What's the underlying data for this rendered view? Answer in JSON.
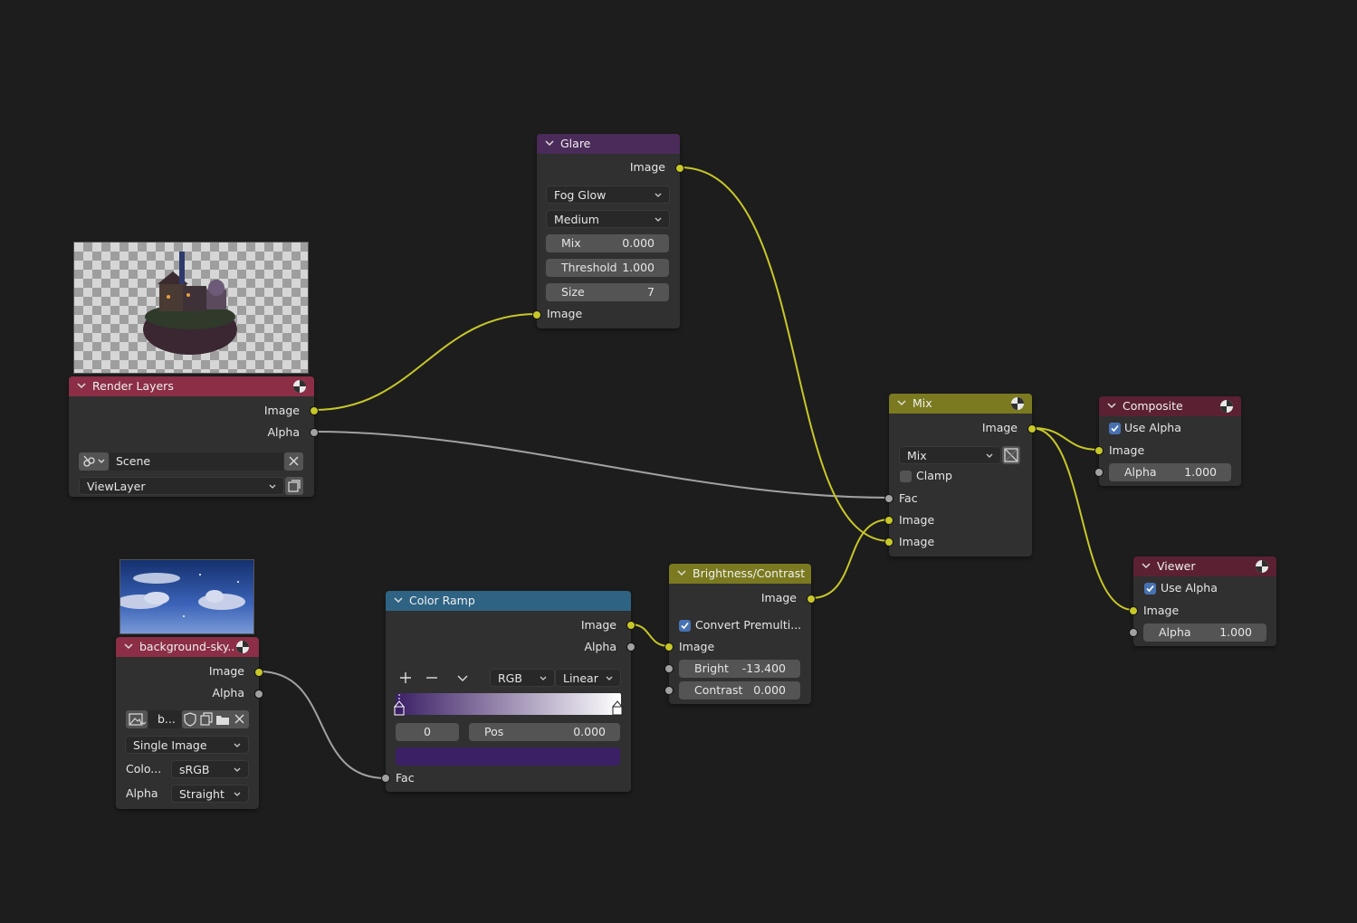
{
  "colors": {
    "render_header": "#8b2e46",
    "image_header": "#8b2e46",
    "output_header": "#5b2133",
    "glare_header": "#4a2b59",
    "mix_header": "#7b7a20",
    "brightness_header": "#7b7a20",
    "color_ramp_header": "#2e6384",
    "socket_yellow": "#c7c729",
    "socket_grey": "#a1a1a1",
    "ramp_stop_color": "#3c2066"
  },
  "glare": {
    "title": "Glare",
    "out_image": "Image",
    "type": "Fog Glow",
    "quality": "Medium",
    "mix_label": "Mix",
    "mix_value": "0.000",
    "threshold_label": "Threshold",
    "threshold_value": "1.000",
    "size_label": "Size",
    "size_value": "7",
    "in_image": "Image"
  },
  "render_layers": {
    "title": "Render Layers",
    "out_image": "Image",
    "out_alpha": "Alpha",
    "scene": "Scene",
    "view_layer": "ViewLayer"
  },
  "mix": {
    "title": "Mix",
    "out_image": "Image",
    "blend": "Mix",
    "clamp": "Clamp",
    "in_fac": "Fac",
    "in_image1": "Image",
    "in_image2": "Image"
  },
  "composite": {
    "title": "Composite",
    "use_alpha": "Use Alpha",
    "in_image": "Image",
    "alpha_label": "Alpha",
    "alpha_value": "1.000"
  },
  "viewer": {
    "title": "Viewer",
    "use_alpha": "Use Alpha",
    "in_image": "Image",
    "alpha_label": "Alpha",
    "alpha_value": "1.000"
  },
  "image_node": {
    "title": "background-sky...",
    "out_image": "Image",
    "out_alpha": "Alpha",
    "image_name": "b...",
    "source": "Single Image",
    "colorspace_label": "Colo...",
    "colorspace": "sRGB",
    "alpha_label": "Alpha",
    "alpha_mode": "Straight"
  },
  "color_ramp": {
    "title": "Color Ramp",
    "out_image": "Image",
    "out_alpha": "Alpha",
    "color_mode": "RGB",
    "interpolation": "Linear",
    "stop_index": "0",
    "pos_label": "Pos",
    "pos_value": "0.000",
    "in_fac": "Fac"
  },
  "brightness": {
    "title": "Brightness/Contrast",
    "out_image": "Image",
    "convert": "Convert Premulti...",
    "in_image": "Image",
    "bright_label": "Bright",
    "bright_value": "-13.400",
    "contrast_label": "Contrast",
    "contrast_value": "0.000"
  }
}
